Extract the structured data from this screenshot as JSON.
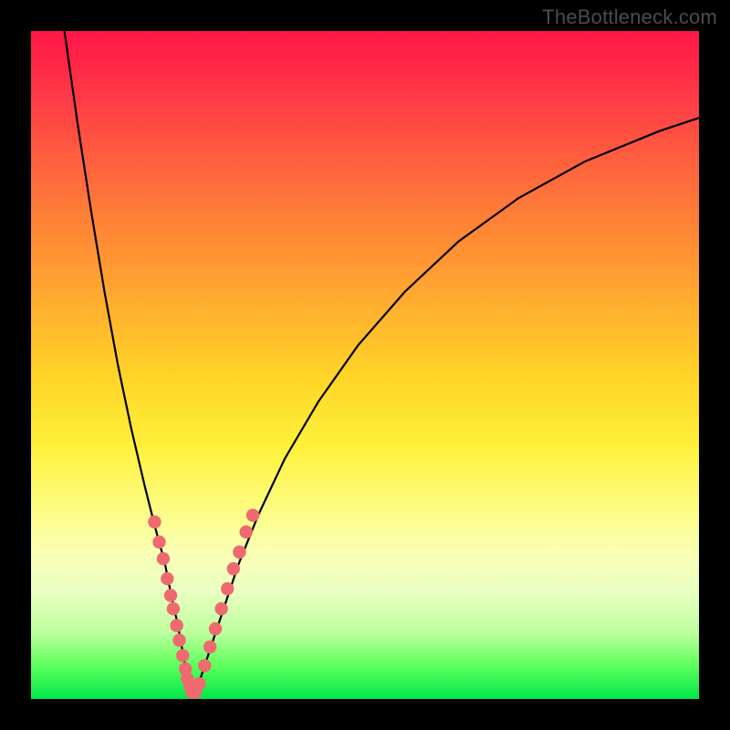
{
  "watermark": "TheBottleneck.com",
  "colors": {
    "black": "#000000",
    "dot": "#ef6a6f",
    "gradient_top": "#ff1648",
    "gradient_bottom": "#00e84a"
  },
  "chart_data": {
    "type": "line",
    "title": "",
    "xlabel": "",
    "ylabel": "",
    "xlim": [
      0,
      100
    ],
    "ylim": [
      0,
      100
    ],
    "series": [
      {
        "name": "left-branch",
        "x": [
          5,
          7,
          9,
          11,
          13,
          15,
          17,
          18.5,
          20,
          21,
          22,
          22.8,
          23.5,
          24
        ],
        "values": [
          100,
          86,
          73,
          61,
          50,
          40.5,
          32,
          26,
          20.5,
          15.5,
          11,
          6.5,
          3,
          0.5
        ]
      },
      {
        "name": "right-branch",
        "x": [
          24.5,
          25.5,
          27,
          29,
          31,
          34,
          38,
          43,
          49,
          56,
          64,
          73,
          83,
          94,
          100
        ],
        "values": [
          0.5,
          3.5,
          8,
          14,
          20,
          27.5,
          36,
          44.5,
          53,
          61,
          68.5,
          75,
          80.5,
          85,
          87
        ]
      }
    ],
    "data_points": {
      "name": "highlighted-points",
      "points": [
        {
          "x": 18.5,
          "y": 26.5
        },
        {
          "x": 19.2,
          "y": 23.5
        },
        {
          "x": 19.8,
          "y": 21.0
        },
        {
          "x": 20.4,
          "y": 18.0
        },
        {
          "x": 20.9,
          "y": 15.5
        },
        {
          "x": 21.3,
          "y": 13.5
        },
        {
          "x": 21.8,
          "y": 11.0
        },
        {
          "x": 22.2,
          "y": 8.8
        },
        {
          "x": 22.7,
          "y": 6.5
        },
        {
          "x": 23.1,
          "y": 4.5
        },
        {
          "x": 23.4,
          "y": 3.0
        },
        {
          "x": 23.8,
          "y": 1.8
        },
        {
          "x": 24.1,
          "y": 1.0
        },
        {
          "x": 24.6,
          "y": 1.0
        },
        {
          "x": 25.2,
          "y": 2.3
        },
        {
          "x": 26.0,
          "y": 5.0
        },
        {
          "x": 26.8,
          "y": 7.8
        },
        {
          "x": 27.6,
          "y": 10.5
        },
        {
          "x": 28.5,
          "y": 13.5
        },
        {
          "x": 29.4,
          "y": 16.5
        },
        {
          "x": 30.3,
          "y": 19.5
        },
        {
          "x": 31.2,
          "y": 22.0
        },
        {
          "x": 32.2,
          "y": 25.0
        },
        {
          "x": 33.2,
          "y": 27.5
        }
      ]
    }
  }
}
